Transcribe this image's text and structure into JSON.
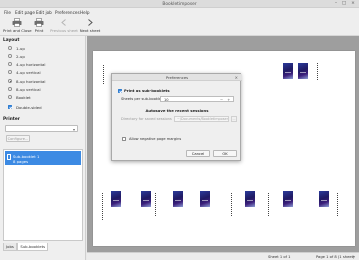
{
  "window": {
    "title": "Bookletimposer"
  },
  "menubar": [
    "File",
    "Edit page",
    "Edit job",
    "Preferences",
    "Help"
  ],
  "toolbar": {
    "print_close": "Print and Close",
    "print": "Print",
    "previous_sheet": "Previous sheet",
    "next_sheet": "Next sheet"
  },
  "layout": {
    "title": "Layout",
    "options": [
      "1-up",
      "2-up",
      "4-up horizontal",
      "4-up vertical",
      "8-up horizontal",
      "8-up vertical",
      "Booklet"
    ],
    "selected": "8-up horizontal",
    "double_sided": "Double-sided"
  },
  "printer": {
    "title": "Printer",
    "selected_value": "",
    "configure": "Configure..."
  },
  "jobs": {
    "items": [
      {
        "name": "Sub-booklet 1",
        "pages": "8 pages"
      }
    ]
  },
  "tabs": [
    "Jobs",
    "Sub-booklets"
  ],
  "status": {
    "sheet": "Sheet 1 of 1",
    "page": "Page 1 of 8 (1 sheet)"
  },
  "dialog": {
    "title": "Preferences",
    "print_as_subbooklets": "Print as sub-booklets",
    "sheets_label": "Sheets per sub-booklet",
    "sheets_value": "10",
    "autosave_heading": "Autosave the recent sessions",
    "dir_label": "Directory for saved sessions",
    "dir_value": "~/Documents/Bookletimposer/Recent Sessions/",
    "dir_button": "...",
    "allow_negative": "Allow negative page margins",
    "cancel": "Cancel",
    "ok": "OK"
  },
  "colors": {
    "accent": "#3c8ae3",
    "canvas": "#9e9e9e",
    "cover": "#1f1a63"
  },
  "icons": [
    "print-close-icon",
    "print-icon",
    "previous-sheet-icon",
    "next-sheet-icon",
    "close-icon",
    "chevron-down-icon",
    "document-icon"
  ]
}
